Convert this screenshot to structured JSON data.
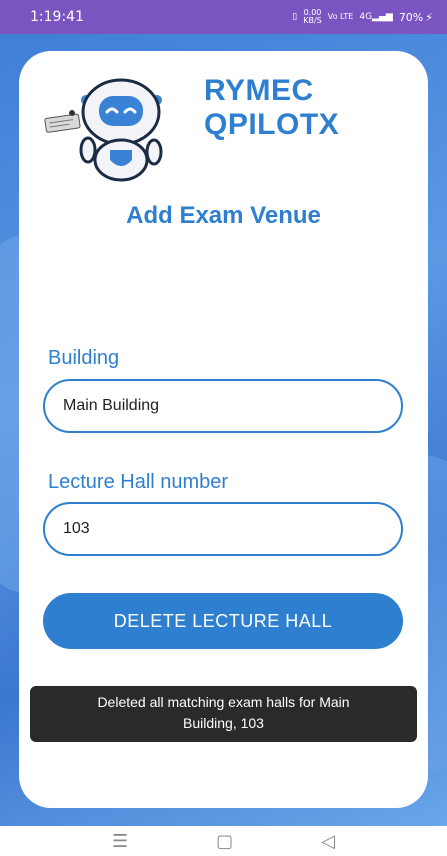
{
  "status_bar": {
    "time": "1:19:41",
    "network_speed": "0.00",
    "network_unit": "KB/S",
    "volte": "Vo LTE",
    "signal_label": "4G",
    "battery": "70%"
  },
  "brand": {
    "line1": "RYMEC",
    "line2": "QPILOTX"
  },
  "page_title": "Add Exam Venue",
  "form": {
    "building_label": "Building",
    "building_value": "Main Building",
    "hall_label": "Lecture Hall number",
    "hall_value": "103",
    "delete_button": "DELETE LECTURE HALL"
  },
  "toast": {
    "line1": "Deleted all matching exam halls for Main",
    "line2": "Building,  103"
  },
  "colors": {
    "accent": "#2f7fd0",
    "status_bar": "#7a55c2",
    "toast_bg": "#2a2a2a"
  },
  "icons": {
    "vibrate": "vibrate-icon",
    "signal": "signal-icon",
    "battery": "battery-charging-icon",
    "nav_menu": "menu-icon",
    "nav_home": "home-square-icon",
    "nav_back": "back-triangle-icon"
  }
}
